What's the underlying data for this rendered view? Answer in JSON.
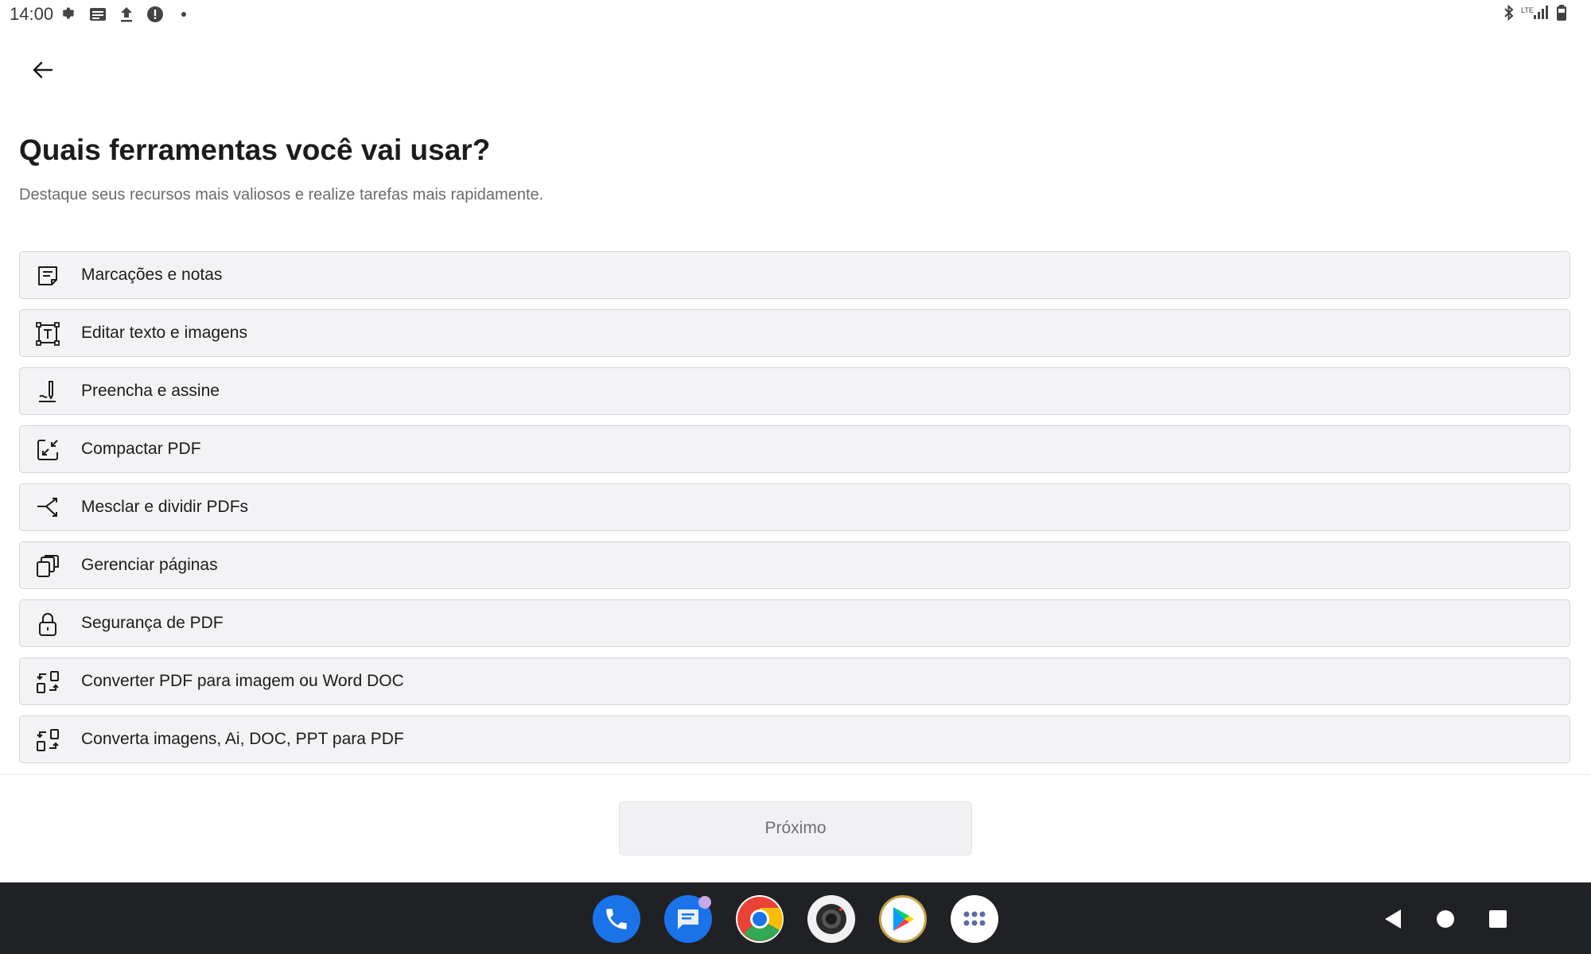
{
  "status_bar": {
    "time": "14:00",
    "left_icons": [
      "gear-icon",
      "news-icon",
      "upload-icon",
      "alert-icon",
      "dot-icon"
    ],
    "right_icons": [
      "bluetooth-icon",
      "lte-signal-icon",
      "battery-icon"
    ],
    "network_label": "LTE"
  },
  "header": {
    "back_icon": "arrow-left-icon",
    "title": "Quais ferramentas você vai usar?",
    "subtitle": "Destaque seus recursos mais valiosos e realize tarefas mais rapidamente."
  },
  "tools": [
    {
      "label": "Marcações e notas",
      "icon": "note-icon"
    },
    {
      "label": "Editar texto e imagens",
      "icon": "text-box-icon"
    },
    {
      "label": "Preencha e assine",
      "icon": "sign-pen-icon"
    },
    {
      "label": "Compactar PDF",
      "icon": "compress-icon"
    },
    {
      "label": "Mesclar e dividir PDFs",
      "icon": "merge-split-icon"
    },
    {
      "label": "Gerenciar páginas",
      "icon": "pages-stack-icon"
    },
    {
      "label": "Segurança de PDF",
      "icon": "lock-icon"
    },
    {
      "label": "Converter PDF para imagem ou Word DOC",
      "icon": "convert-icon"
    },
    {
      "label": "Converta imagens, Ai, DOC, PPT para PDF",
      "icon": "convert-icon"
    }
  ],
  "footer": {
    "next_label": "Próximo"
  },
  "navbar": {
    "dock": [
      "phone-app-icon",
      "messages-app-icon",
      "chrome-app-icon",
      "camera-app-icon",
      "play-store-app-icon",
      "app-drawer-icon"
    ],
    "keys": [
      "back-key-icon",
      "home-key-icon",
      "recents-key-icon"
    ]
  },
  "colors": {
    "item_bg": "#f3f3f5",
    "item_border": "#d4d4da",
    "navbar_bg": "#202124",
    "next_button_bg": "#f1f1f3"
  }
}
